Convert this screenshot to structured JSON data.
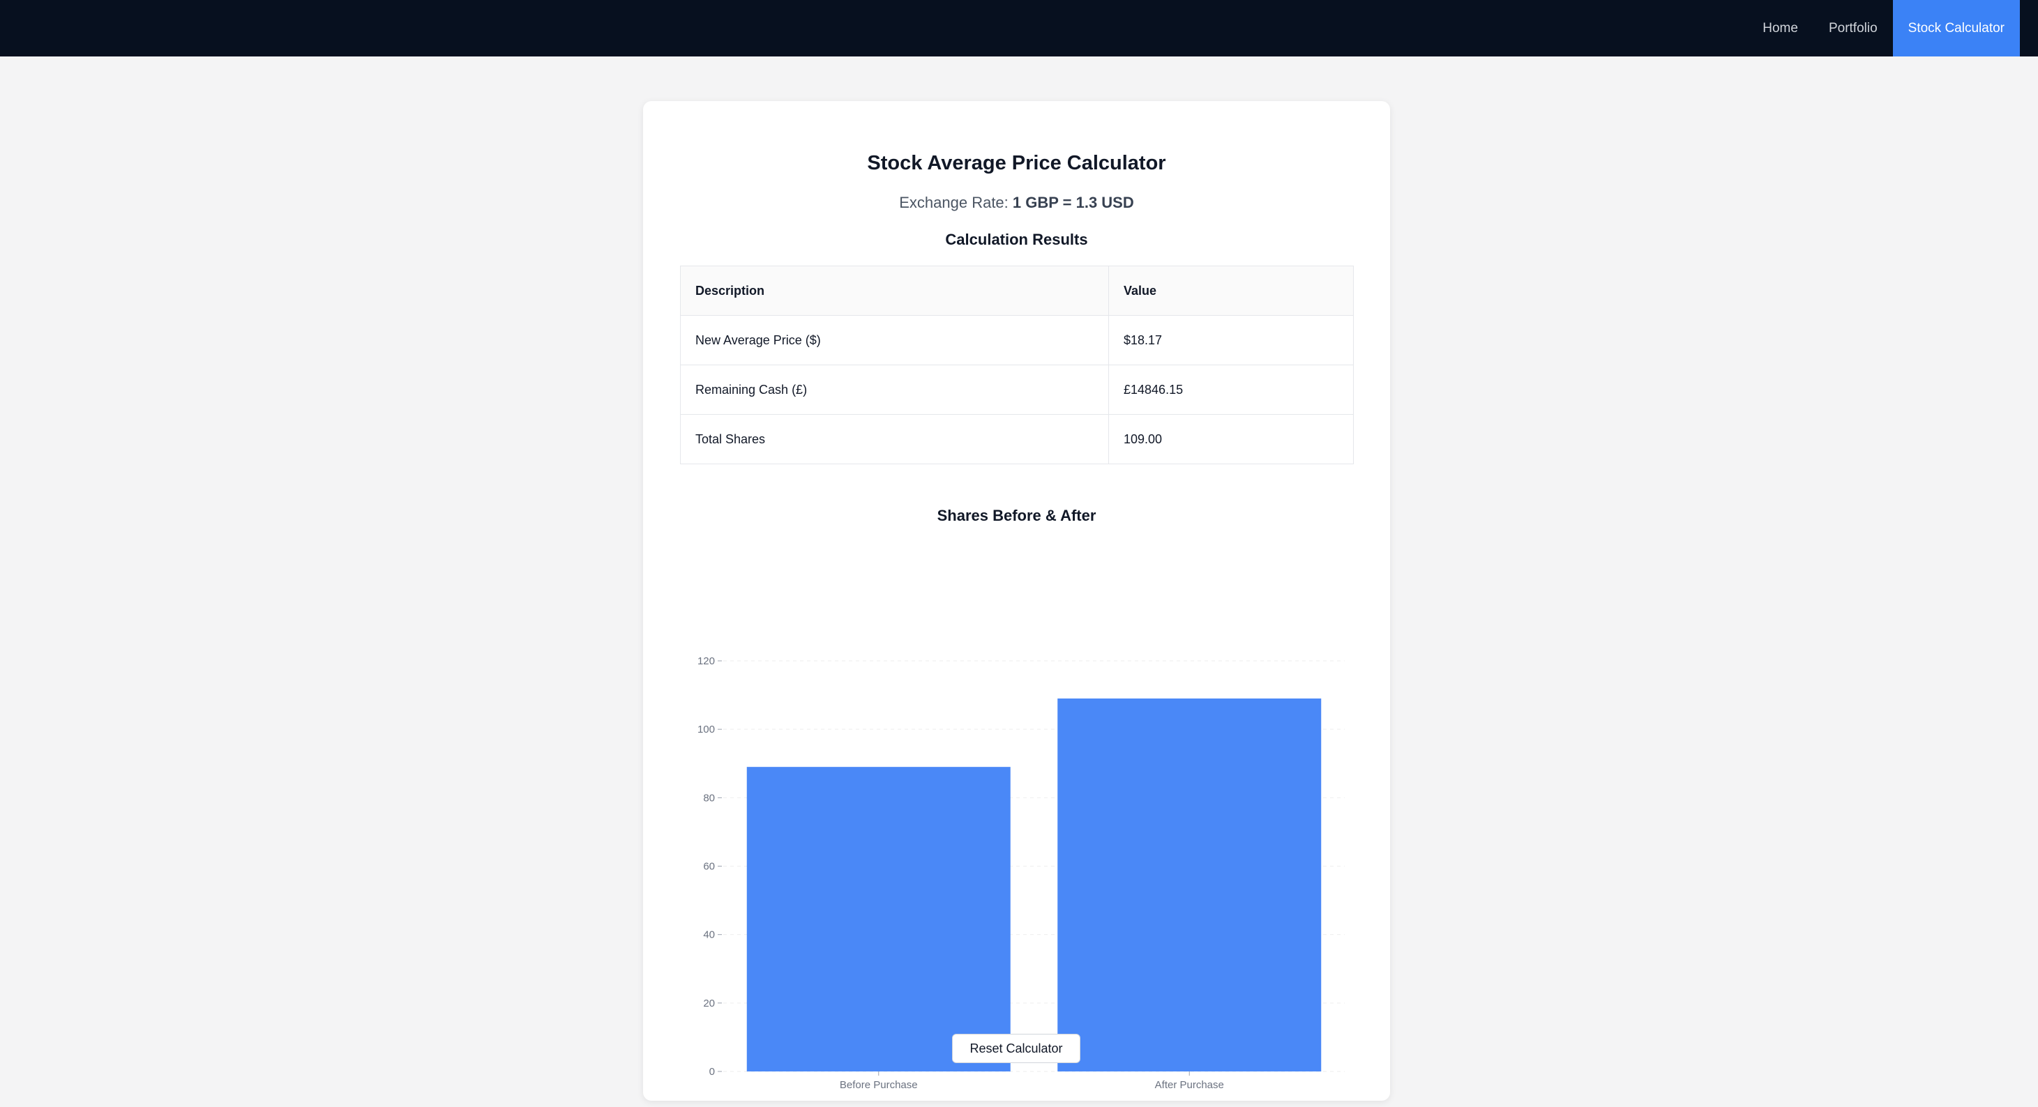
{
  "nav": {
    "items": [
      {
        "label": "Home",
        "active": false
      },
      {
        "label": "Portfolio",
        "active": false
      },
      {
        "label": "Stock Calculator",
        "active": true
      }
    ]
  },
  "calculator": {
    "title": "Stock Average Price Calculator",
    "exchange_rate_prefix": "Exchange Rate: ",
    "exchange_rate_value": "1 GBP = 1.3 USD",
    "results_heading": "Calculation Results",
    "table": {
      "headers": [
        "Description",
        "Value"
      ],
      "rows": [
        [
          "New Average Price ($)",
          "$18.17"
        ],
        [
          "Remaining Cash (£)",
          "£14846.15"
        ],
        [
          "Total Shares",
          "109.00"
        ]
      ]
    },
    "reset_label": "Reset Calculator"
  },
  "colors": {
    "accent": "#3b82f6",
    "navbar": "#07101f",
    "bar": "#4a88f7"
  },
  "chart_data": {
    "type": "bar",
    "title": "Shares Before & After",
    "categories": [
      "Before Purchase",
      "After Purchase"
    ],
    "values": [
      89,
      109
    ],
    "ylim": [
      0,
      120
    ],
    "yticks": [
      0,
      20,
      40,
      60,
      80,
      100,
      120
    ],
    "xlabel": "",
    "ylabel": "",
    "grid": true
  }
}
